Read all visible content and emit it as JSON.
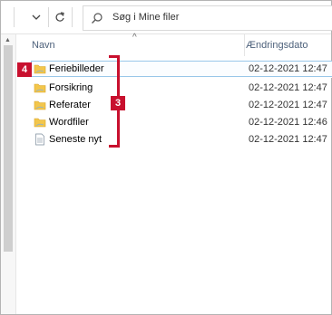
{
  "search": {
    "placeholder": "Søg i Mine filer"
  },
  "columns": {
    "name": "Navn",
    "date": "Ændringsdato"
  },
  "files": [
    {
      "name": "Feriebilleder",
      "date": "02-12-2021 12:47",
      "type": "folder"
    },
    {
      "name": "Forsikring",
      "date": "02-12-2021 12:47",
      "type": "folder"
    },
    {
      "name": "Referater",
      "date": "02-12-2021 12:47",
      "type": "folder"
    },
    {
      "name": "Wordfiler",
      "date": "02-12-2021 12:46",
      "type": "folder"
    },
    {
      "name": "Seneste nyt",
      "date": "02-12-2021 12:47",
      "type": "document"
    }
  ],
  "callouts": {
    "item": "4",
    "group": "3"
  },
  "colors": {
    "callout": "#c8102e",
    "folder": "#f3c64b",
    "selection": "#99c7e9"
  }
}
